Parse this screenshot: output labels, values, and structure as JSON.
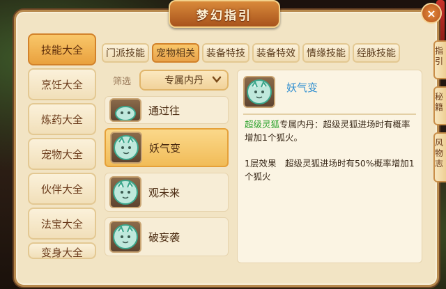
{
  "title": "梦幻指引",
  "close_label": "×",
  "categories": [
    {
      "label": "技能大全",
      "active": true
    },
    {
      "label": "烹饪大全"
    },
    {
      "label": "炼药大全"
    },
    {
      "label": "宠物大全"
    },
    {
      "label": "伙伴大全"
    },
    {
      "label": "法宝大全"
    },
    {
      "label": "变身大全",
      "partial": true
    }
  ],
  "tabs": [
    {
      "label": "门派技能"
    },
    {
      "label": "宠物相关",
      "active": true
    },
    {
      "label": "装备特技"
    },
    {
      "label": "装备特效"
    },
    {
      "label": "情缘技能"
    },
    {
      "label": "经脉技能"
    }
  ],
  "filter": {
    "label": "筛选",
    "selected": "专属内丹",
    "icon": "chevron-down-icon"
  },
  "skills": [
    {
      "name": "通过往",
      "icon": "fox-spirit-icon"
    },
    {
      "name": "妖气变",
      "icon": "fox-spirit-icon",
      "active": true
    },
    {
      "name": "观未来",
      "icon": "fox-spirit-icon"
    },
    {
      "name": "破妄袭",
      "icon": "fox-spirit-icon"
    }
  ],
  "detail": {
    "name": "妖气变",
    "highlight": "超级灵狐",
    "desc": "专属内丹：超级灵狐进场时有概率增加1个狐火。",
    "level_effect": "1层效果　超级灵狐进场时有50%概率增加1个狐火"
  },
  "side_tabs": [
    {
      "label": "指引"
    },
    {
      "label": "秘籍"
    },
    {
      "label": "风物志"
    }
  ],
  "colors": {
    "accent": "#e9a13e",
    "link": "#2f8ed0",
    "highlight": "#2aa12a"
  }
}
